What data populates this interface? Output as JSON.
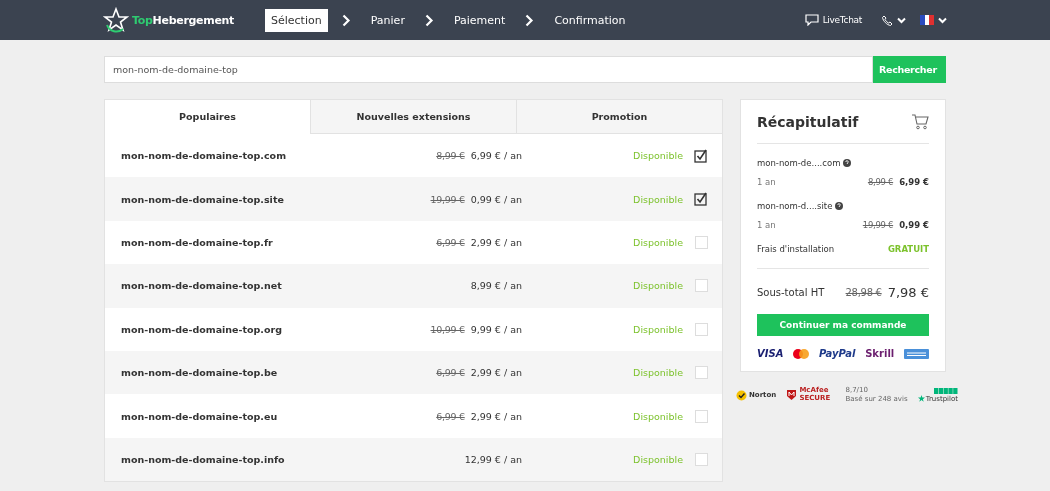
{
  "header": {
    "logo": {
      "part_1": "Top",
      "part_2": "Hebergement"
    },
    "steps": [
      {
        "label": "Sélection",
        "selected": true
      },
      {
        "label": "Panier",
        "selected": false
      },
      {
        "label": "Paiement",
        "selected": false
      },
      {
        "label": "Confirmation",
        "selected": false
      }
    ],
    "chat": "LiveTchat"
  },
  "search": {
    "value": "mon-nom-de-domaine-top",
    "button": "Rechercher"
  },
  "tabs": [
    {
      "label": "Populaires",
      "selected": true
    },
    {
      "label": "Nouvelles extensions",
      "selected": false
    },
    {
      "label": "Promotion",
      "selected": false
    }
  ],
  "rows": [
    {
      "domain": "mon-nom-de-domaine-top.com",
      "old_price": "8,99 €",
      "price": "6,99 € / an",
      "status": "Disponible",
      "checked": true
    },
    {
      "domain": "mon-nom-de-domaine-top.site",
      "old_price": "19,99 €",
      "price": "0,99 € / an",
      "status": "Disponible",
      "checked": true
    },
    {
      "domain": "mon-nom-de-domaine-top.fr",
      "old_price": "6,99 €",
      "price": "2,99 € / an",
      "status": "Disponible",
      "checked": false
    },
    {
      "domain": "mon-nom-de-domaine-top.net",
      "price": "8,99 € / an",
      "status": "Disponible",
      "checked": false
    },
    {
      "domain": "mon-nom-de-domaine-top.org",
      "old_price": "10,99 €",
      "price": "9,99 € / an",
      "status": "Disponible",
      "checked": false
    },
    {
      "domain": "mon-nom-de-domaine-top.be",
      "old_price": "6,99 €",
      "price": "2,99 € / an",
      "status": "Disponible",
      "checked": false
    },
    {
      "domain": "mon-nom-de-domaine-top.eu",
      "old_price": "6,99 €",
      "price": "2,99 € / an",
      "status": "Disponible",
      "checked": false
    },
    {
      "domain": "mon-nom-de-domaine-top.info",
      "price": "12,99 € / an",
      "status": "Disponible",
      "checked": false
    }
  ],
  "summary": {
    "title": "Récapitulatif",
    "items": [
      {
        "name": "mon-nom-de....com",
        "period": "1 an",
        "old_price": "8,99 €",
        "price": "6,99 €"
      },
      {
        "name": "mon-nom-d....site",
        "period": "1 an",
        "old_price": "19,99 €",
        "price": "0,99 €"
      }
    ],
    "fee": {
      "label": "Frais d'installation",
      "value": "GRATUIT"
    },
    "subtotal": {
      "label": "Sous-total HT",
      "old_price": "28,98 €",
      "price": "7,98 €"
    },
    "button": "Continuer ma commande",
    "payments": {
      "visa": "VISA",
      "paypal": "PayPal",
      "skrill": "Skrill"
    }
  },
  "trust": {
    "norton": "Norton",
    "mcafee": "McAfee SECURE",
    "rating": "8,7/10",
    "reviews": "Basé sur 248 avis",
    "trustpilot": "Trustpilot"
  }
}
